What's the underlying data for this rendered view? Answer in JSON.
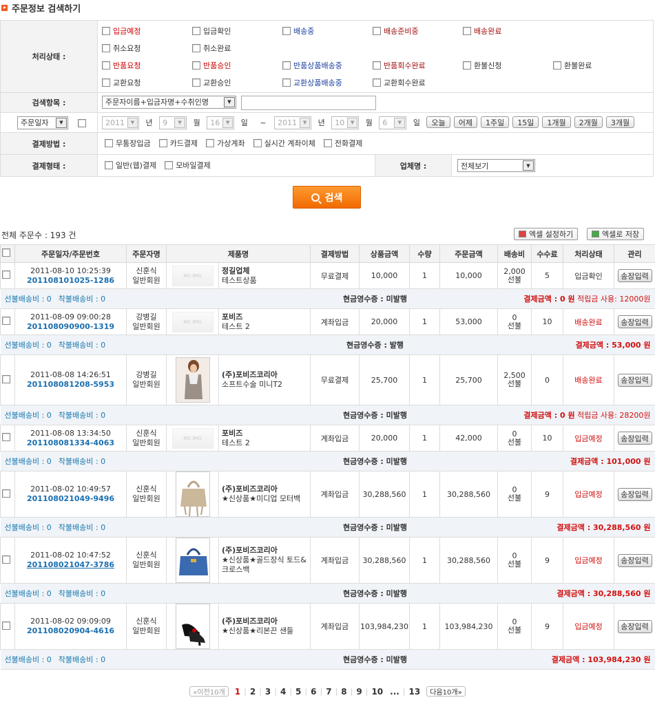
{
  "page_title": "주문정보 검색하기",
  "search": {
    "status_label": "처리상태 :",
    "status_rows": [
      [
        {
          "t": "입금예정",
          "c": "red"
        },
        {
          "t": "입금확인",
          "c": ""
        },
        {
          "t": "배송중",
          "c": "blue"
        },
        {
          "t": "배송준비중",
          "c": "dkred"
        },
        {
          "t": "배송완료",
          "c": "dkred"
        }
      ],
      [
        {
          "t": "취소요청",
          "c": ""
        },
        {
          "t": "취소완료",
          "c": ""
        }
      ],
      [
        {
          "t": "반품요청",
          "c": "red"
        },
        {
          "t": "반품승인",
          "c": "red"
        },
        {
          "t": "반품상품배송중",
          "c": "blue"
        },
        {
          "t": "반품회수완료",
          "c": "dkred"
        },
        {
          "t": "환불신청",
          "c": ""
        },
        {
          "t": "환불완료",
          "c": ""
        }
      ],
      [
        {
          "t": "교환요청",
          "c": ""
        },
        {
          "t": "교환승인",
          "c": ""
        },
        {
          "t": "교환상품배송중",
          "c": "blue"
        },
        {
          "t": "교환회수완료",
          "c": ""
        }
      ]
    ],
    "field_label": "검색항목 :",
    "field_select": "주문자이름+입금자명+수취인명",
    "date_select": "주문일자",
    "from": {
      "year": "2011",
      "year_unit": "년",
      "month": "9",
      "month_unit": "월",
      "day": "16",
      "day_unit": "일"
    },
    "tilde": "~",
    "to": {
      "year": "2011",
      "year_unit": "년",
      "month": "10",
      "month_unit": "월",
      "day": "6",
      "day_unit": "일"
    },
    "quick_buttons": [
      "오늘",
      "어제",
      "1주일",
      "15일",
      "1개월",
      "2개월",
      "3개월"
    ],
    "pay_method_label": "결제방법 :",
    "pay_methods": [
      "무통장입금",
      "카드결제",
      "가상계좌",
      "실시간 계좌이체",
      "전화결제"
    ],
    "pay_type_label": "결제형태 :",
    "pay_types": [
      "일반(웹)결제",
      "모바일결제"
    ],
    "vendor_label": "업체명 :",
    "vendor_select": "전체보기",
    "search_button": "검색"
  },
  "summary": {
    "total_text": "전체 주문수 : 193 건",
    "excel_settings": "엑셀 설정하기",
    "excel_save": "엑셀로 저장"
  },
  "table": {
    "headers": [
      "주문일자/주문번호",
      "주문자명",
      "제품명",
      "결제방법",
      "상품금액",
      "수량",
      "주문금액",
      "배송비",
      "수수료",
      "처리상태",
      "관리"
    ],
    "manage_button": "송장입력",
    "rows": [
      {
        "date": "2011-08-10 10:25:39",
        "order_no": "201108101025-1286",
        "buyer": "신훈식",
        "grade": "일반회원",
        "img": "noimg",
        "pname": "정길업체",
        "pdesc": "테스트상품",
        "pay": "무료결제",
        "price": "10,000",
        "qty": "1",
        "total": "10,000",
        "ship_amt": "2,000",
        "ship_type": "선불",
        "fee": "5",
        "status": "입금확인",
        "status_color": "#333",
        "prepaid": "선불배송비 : 0",
        "cod": "착불배송비 : 0",
        "receipt": "현금영수증 : 미발행",
        "settle": "결제금액 : 0 원",
        "note": " 적립금 사용: 12000원"
      },
      {
        "date": "2011-08-09 09:00:28",
        "order_no": "201108090900-1319",
        "buyer": "강병길",
        "grade": "일반회원",
        "img": "noimg",
        "pname": "포비즈",
        "pdesc": "테스트 2",
        "pay": "계좌입금",
        "price": "20,000",
        "qty": "1",
        "total": "53,000",
        "ship_amt": "0",
        "ship_type": "선불",
        "fee": "10",
        "status": "배송완료",
        "status_color": "#d01010",
        "prepaid": "선불배송비 : 0",
        "cod": "착불배송비 : 0",
        "receipt": "현금영수증 : 발행",
        "settle": "결제금액 : 53,000 원",
        "note": ""
      },
      {
        "date": "2011-08-08 14:26:51",
        "order_no": "201108081208-5953",
        "buyer": "강병길",
        "grade": "일반회원",
        "img": "dress",
        "pname": "(주)포비즈코리아",
        "pdesc": "소프트수술 미니T2",
        "pay": "무료결제",
        "price": "25,700",
        "qty": "1",
        "total": "25,700",
        "ship_amt": "2,500",
        "ship_type": "선불",
        "fee": "0",
        "status": "배송완료",
        "status_color": "#d01010",
        "prepaid": "선불배송비 : 0",
        "cod": "착불배송비 : 0",
        "receipt": "현금영수증 : 미발행",
        "settle": "결제금액 : 0 원",
        "note": " 적립금 사용: 28200원"
      },
      {
        "date": "2011-08-08 13:34:50",
        "order_no": "201108081334-4063",
        "buyer": "신훈식",
        "grade": "일반회원",
        "img": "noimg",
        "pname": "포비즈",
        "pdesc": "테스트 2",
        "pay": "계좌입금",
        "price": "20,000",
        "qty": "1",
        "total": "42,000",
        "ship_amt": "0",
        "ship_type": "선불",
        "fee": "10",
        "status": "입금예정",
        "status_color": "#d01010",
        "prepaid": "선불배송비 : 0",
        "cod": "착불배송비 : 0",
        "receipt": "현금영수증 : 미발행",
        "settle": "결제금액 : 101,000 원",
        "note": ""
      },
      {
        "date": "2011-08-02 10:49:57",
        "order_no": "201108021049-9496",
        "buyer": "신훈식",
        "grade": "일반회원",
        "img": "bag1",
        "pname": "(주)포비즈코리아",
        "pdesc": "★신상품★미디업 모터백",
        "pay": "계좌입금",
        "price": "30,288,560",
        "qty": "1",
        "total": "30,288,560",
        "ship_amt": "0",
        "ship_type": "선불",
        "fee": "9",
        "status": "입금예정",
        "status_color": "#d01010",
        "prepaid": "선불배송비 : 0",
        "cod": "착불배송비 : 0",
        "receipt": "현금영수증 : 미발행",
        "settle": "결제금액 : 30,288,560 원",
        "note": ""
      },
      {
        "date": "2011-08-02 10:47:52",
        "order_no": "201108021047-3786",
        "buyer": "신훈식",
        "grade": "일반회원",
        "img": "bag2",
        "pname": "(주)포비즈코리아",
        "pdesc": "★신상품★골드장식 토드&크로스백",
        "pay": "계좌입금",
        "price": "30,288,560",
        "qty": "1",
        "total": "30,288,560",
        "ship_amt": "0",
        "ship_type": "선불",
        "fee": "9",
        "status": "입금예정",
        "status_color": "#d01010",
        "prepaid": "선불배송비 : 0",
        "cod": "착불배송비 : 0",
        "receipt": "현금영수증 : 미발행",
        "settle": "결제금액 : 30,288,560 원",
        "note": ""
      },
      {
        "date": "2011-08-02 09:09:09",
        "order_no": "201108020904-4616",
        "buyer": "신훈식",
        "grade": "일반회원",
        "img": "shoes",
        "pname": "(주)포비즈코리아",
        "pdesc": "★신상품★리본끈 샌들",
        "pay": "계좌입금",
        "price": "103,984,230",
        "qty": "1",
        "total": "103,984,230",
        "ship_amt": "0",
        "ship_type": "선불",
        "fee": "9",
        "status": "입금예정",
        "status_color": "#d01010",
        "prepaid": "선불배송비 : 0",
        "cod": "착불배송비 : 0",
        "receipt": "현금영수증 : 미발행",
        "settle": "결제금액 : 103,984,230 원",
        "note": ""
      }
    ]
  },
  "pagination": {
    "prev": "이전10개",
    "pages": [
      "1",
      "2",
      "3",
      "4",
      "5",
      "6",
      "7",
      "8",
      "9",
      "10"
    ],
    "ellipsis": "...",
    "last": "13",
    "next": "다음10개",
    "current": "1"
  }
}
